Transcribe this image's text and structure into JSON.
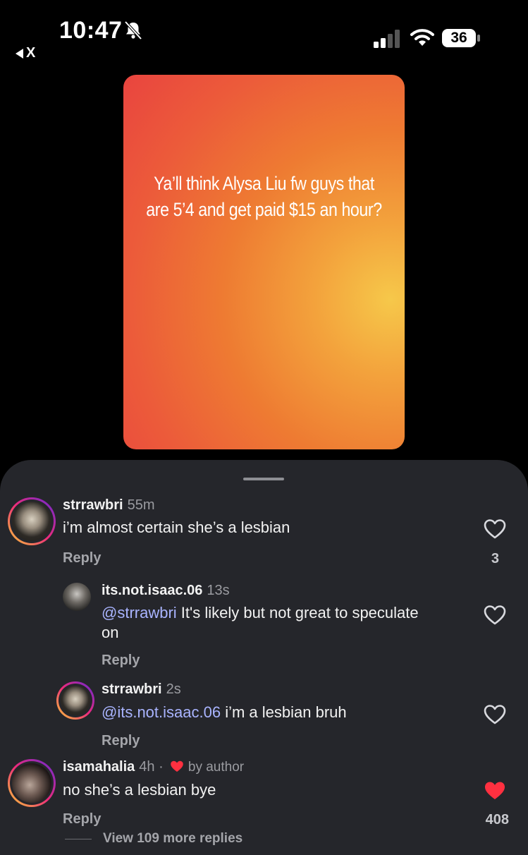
{
  "status": {
    "time": "10:47",
    "back_label": "X",
    "battery": "36"
  },
  "story": {
    "text_line1": "Ya’ll think Alysa Liu fw guys that",
    "text_line2": "are 5’4 and get paid $15 an hour?"
  },
  "comments": [
    {
      "user": "strrawbri",
      "ago": "55m",
      "text": "i’m almost certain she’s a lesbian",
      "reply": "Reply",
      "likes": "3"
    },
    {
      "user": "its.not.isaac.06",
      "ago": "13s",
      "mention": "@strrawbri",
      "text": " It's likely but not great to speculate on",
      "reply": "Reply"
    },
    {
      "user": "strrawbri",
      "ago": "2s",
      "mention": "@its.not.isaac.06",
      "text": " i’m a lesbian bruh",
      "reply": "Reply"
    },
    {
      "user": "isamahalia",
      "ago": "4h ·",
      "by_author": "by author",
      "text": "no she’s a lesbian bye",
      "reply": "Reply",
      "likes": "408"
    }
  ],
  "view_more": "View 109 more replies",
  "colors": {
    "mention": "#a9b4ff",
    "liked_heart": "#ff3040",
    "sheet": "#25262b"
  },
  "icons": [
    "back-arrow-icon",
    "bell-slash-icon",
    "signal-icon",
    "wifi-icon",
    "battery-icon",
    "heart-icon"
  ]
}
